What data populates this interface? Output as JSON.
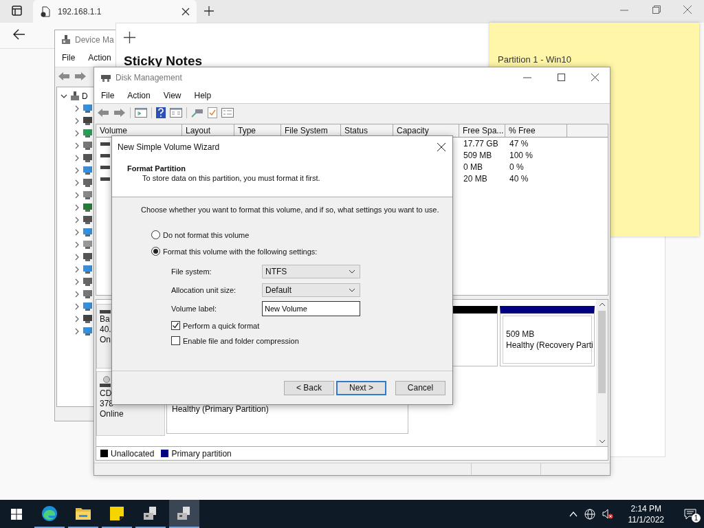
{
  "browser": {
    "tab_title": "192.168.1.1"
  },
  "device_manager": {
    "title": "Device Ma",
    "menu": [
      "File",
      "Action"
    ],
    "tree": {
      "label": "D",
      "expanded": true,
      "children": [
        {
          "expanded": false
        },
        {
          "expanded": false
        },
        {
          "expanded": false
        },
        {
          "expanded": false
        },
        {
          "expanded": false
        },
        {
          "expanded": false
        },
        {
          "expanded": false
        },
        {
          "expanded": false
        },
        {
          "expanded": false
        },
        {
          "expanded": false
        },
        {
          "expanded": false
        },
        {
          "expanded": false
        },
        {
          "expanded": false
        },
        {
          "expanded": false
        },
        {
          "expanded": false
        },
        {
          "expanded": false
        },
        {
          "expanded": false
        },
        {
          "expanded": false
        },
        {
          "expanded": false
        }
      ]
    }
  },
  "sticky_notes": {
    "title": "Sticky Notes",
    "note_text": "Partition 1 - Win10"
  },
  "disk_management": {
    "title": "Disk Management",
    "menu": [
      "File",
      "Action",
      "View",
      "Help"
    ],
    "columns": [
      "Volume",
      "Layout",
      "Type",
      "File System",
      "Status",
      "Capacity",
      "Free Spa...",
      "% Free"
    ],
    "rows": [
      {
        "free_space": "17.77 GB",
        "percent_free": "47 %"
      },
      {
        "free_space": "509 MB",
        "percent_free": "100 %"
      },
      {
        "free_space": "0 MB",
        "percent_free": "0 %"
      },
      {
        "free_space": "20 MB",
        "percent_free": "40 %"
      }
    ],
    "disks": [
      {
        "kind": "hdd",
        "lines": [
          "Ba",
          "40.",
          "On"
        ],
        "partitions": [
          {
            "kind": "unallocated"
          },
          {
            "kind": "primary",
            "lines": [
              "509 MB",
              "Healthy (Recovery Parti"
            ]
          }
        ]
      },
      {
        "kind": "cdrom",
        "lines": [
          "CD",
          "378",
          "Online"
        ],
        "partitions": [
          {
            "kind": "box",
            "lines": [
              "Healthy (Primary Partition)"
            ]
          }
        ]
      }
    ],
    "legend": [
      {
        "kind": "unallocated",
        "label": "Unallocated"
      },
      {
        "kind": "primary",
        "label": "Primary partition"
      }
    ]
  },
  "wizard": {
    "title": "New Simple Volume Wizard",
    "heading": "Format Partition",
    "subheading": "To store data on this partition, you must format it first.",
    "instruction": "Choose whether you want to format this volume, and if so, what settings you want to use.",
    "options": [
      {
        "label": "Do not format this volume",
        "selected": false
      },
      {
        "label": "Format this volume with the following settings:",
        "selected": true
      }
    ],
    "file_system": {
      "label": "File system:",
      "value": "NTFS"
    },
    "allocation_unit_size": {
      "label": "Allocation unit size:",
      "value": "Default"
    },
    "volume_label": {
      "label": "Volume label:",
      "value": "New Volume"
    },
    "checkboxes": [
      {
        "label": "Perform a quick format",
        "checked": true
      },
      {
        "label": "Enable file and folder compression",
        "checked": false
      }
    ],
    "buttons": [
      {
        "label": "< Back",
        "default": false
      },
      {
        "label": "Next >",
        "default": true
      },
      {
        "label": "Cancel",
        "default": false
      }
    ]
  },
  "taskbar": {
    "apps": [
      {
        "kind": "edge",
        "selected": false
      },
      {
        "kind": "folder",
        "selected": false
      },
      {
        "kind": "sticky",
        "selected": false
      },
      {
        "kind": "server",
        "selected": false
      },
      {
        "kind": "server",
        "selected": true
      }
    ],
    "time": "2:14 PM",
    "date": "11/1/2022",
    "notifications": "1"
  }
}
